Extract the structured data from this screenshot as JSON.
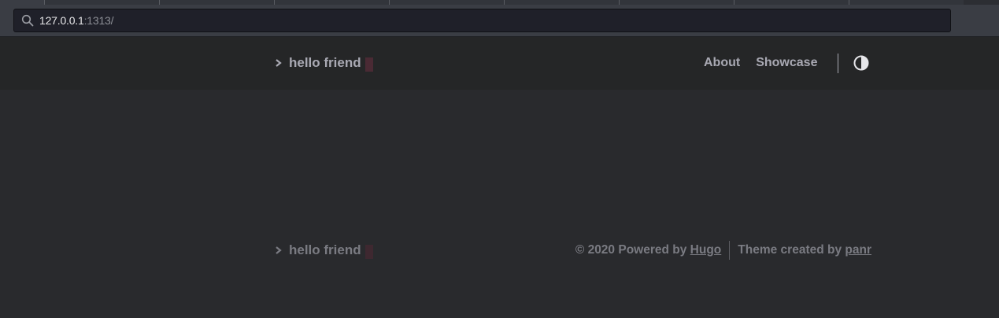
{
  "browser": {
    "url_host": "127.0.0.1",
    "url_rest": ":1313/"
  },
  "header": {
    "logo_text": "hello friend",
    "nav": [
      {
        "label": "About"
      },
      {
        "label": "Showcase"
      }
    ]
  },
  "footer": {
    "logo_text": "hello friend",
    "copyright_prefix": "© 2020 Powered by",
    "hugo_link": "Hugo",
    "theme_prefix": "Theme created by",
    "theme_author": "panr"
  },
  "colors": {
    "background": "#292a2d",
    "header_bg": "#252627",
    "text": "#a9a9b3",
    "cursor_accent": "#4a2a34"
  },
  "icons": {
    "url_search": "search-icon",
    "logo_arrow": "chevron-right-icon",
    "theme_toggle": "half-circle-contrast-icon"
  }
}
